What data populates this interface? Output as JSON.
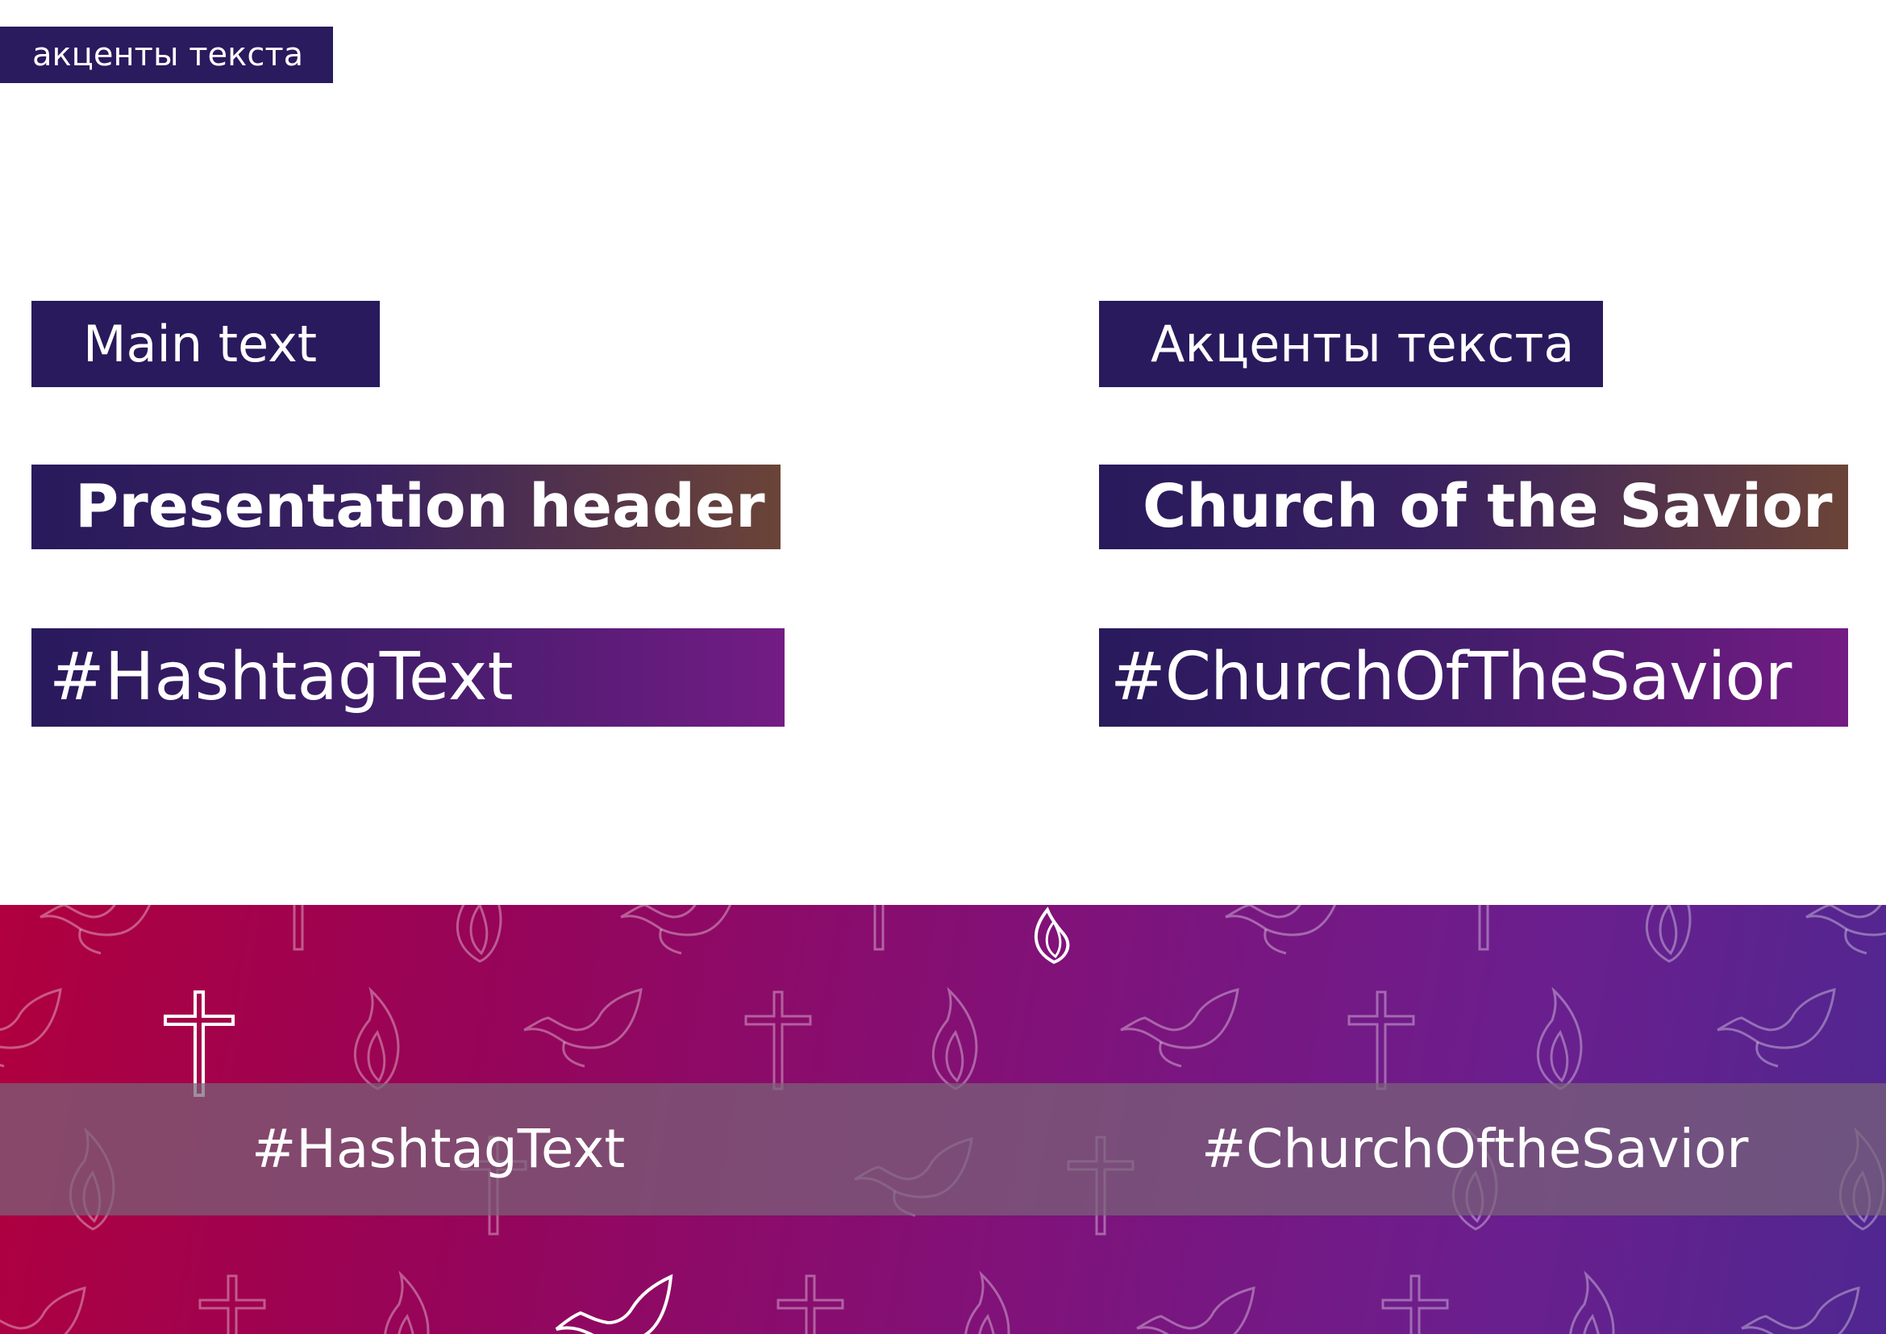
{
  "tag": {
    "label": "акценты текста"
  },
  "left_column": {
    "main_text": "Main text",
    "header": "Presentation header",
    "hashtag": "#HashtagText"
  },
  "right_column": {
    "main_text": "Акценты текста",
    "header": "Church of the Savior",
    "hashtag": "#ChurchOfTheSavior"
  },
  "banner": {
    "hashtag_left": "#HashtagText",
    "hashtag_right": "#ChurchOftheSavior",
    "pattern_icons": [
      "dove-icon",
      "cross-icon",
      "flame-icon"
    ]
  },
  "colors": {
    "deep_indigo": "#281a5c",
    "bronze": "#6b4437",
    "violet": "#731c84",
    "crimson": "#b0003e",
    "banner_violet": "#4f2790"
  }
}
